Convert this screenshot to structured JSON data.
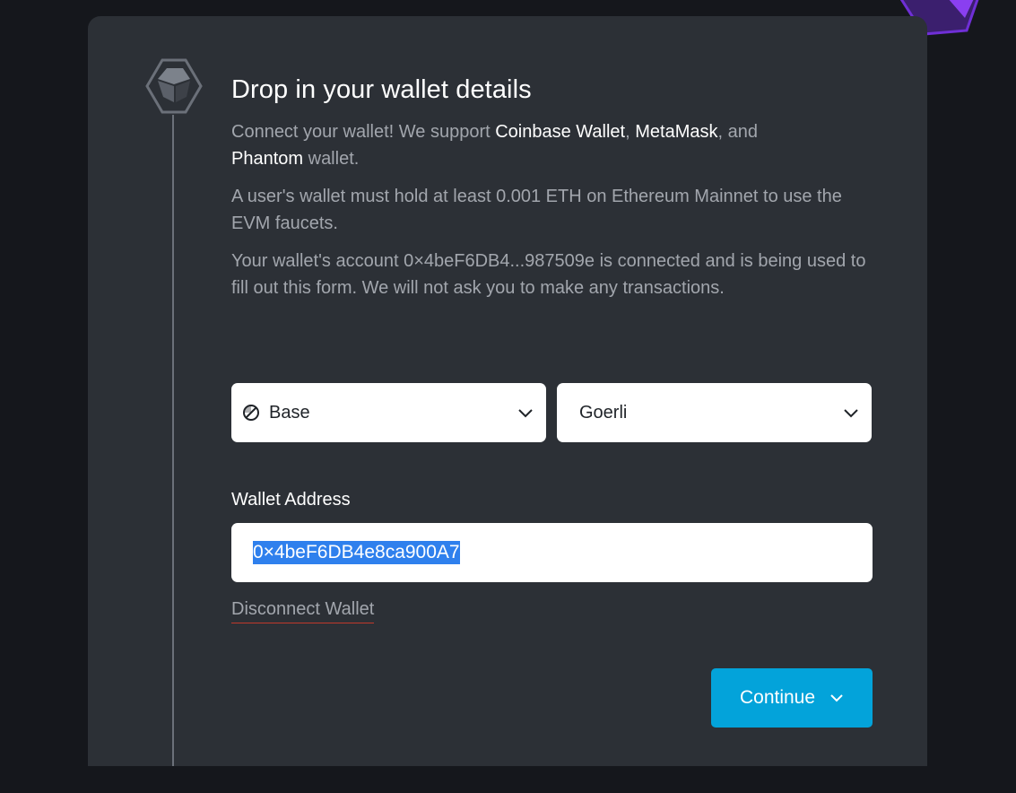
{
  "header": {
    "title": "Drop in your wallet details"
  },
  "intro": {
    "part1": "Connect your wallet! We support ",
    "wallet1": "Coinbase Wallet",
    "sep1": ", ",
    "wallet2": "MetaMask",
    "sep2": ", and",
    "wallet3": "Phantom",
    "part2": " wallet."
  },
  "requirement_text": "A user's wallet must hold at least 0.001 ETH on Ethereum Mainnet to use the EVM faucets.",
  "connected_text": "Your wallet's account 0×4beF6DB4...987509e is connected and is being used to fill out this form. We will not ask you to make any transactions.",
  "network_select": {
    "value": "Base",
    "icon": "base-logo-icon"
  },
  "chain_select": {
    "value": "Goerli"
  },
  "wallet_address": {
    "label": "Wallet Address",
    "value": "0×4beF6DB4e8ca900A7"
  },
  "disconnect_label": "Disconnect Wallet",
  "continue_label": "Continue",
  "colors": {
    "background": "#15171c",
    "card": "#2c3036",
    "accent": "#03a3da",
    "selection": "#2f80ed",
    "muted_text": "#a2a6ad",
    "underline": "#c0392b"
  }
}
